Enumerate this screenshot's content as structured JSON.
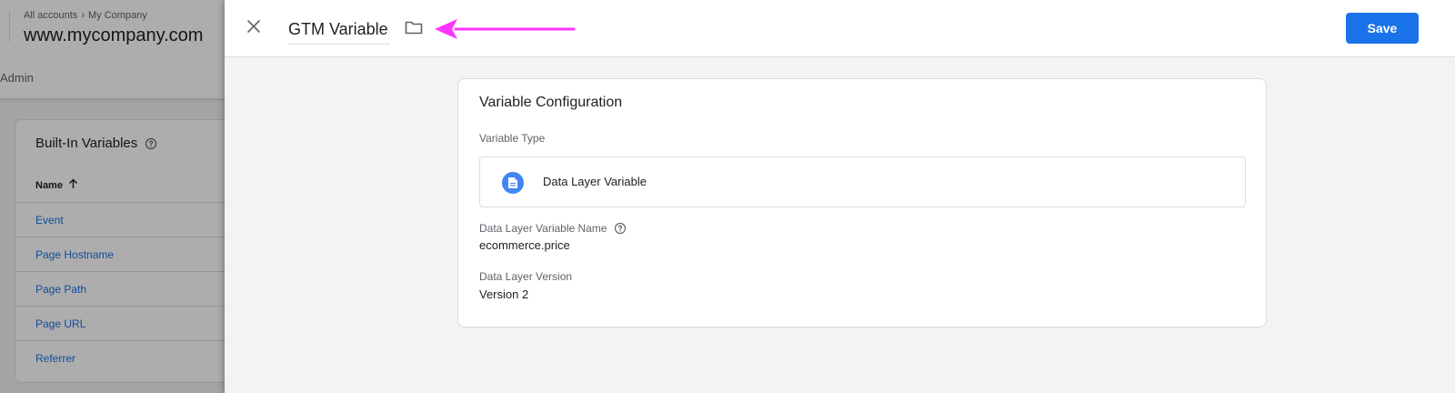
{
  "background": {
    "breadcrumb": [
      "All accounts",
      "My Company"
    ],
    "container_name": "www.mycompany.com",
    "admin_tab": "Admin",
    "builtin_card": {
      "title": "Built-In Variables",
      "column_header": "Name",
      "rows": [
        "Event",
        "Page Hostname",
        "Page Path",
        "Page URL",
        "Referrer"
      ]
    }
  },
  "panel": {
    "title": "GTM Variable",
    "save_label": "Save",
    "colors": {
      "accent": "#1a73e8",
      "annotation_arrow": "#ff33ff",
      "type_icon": "#4285f4"
    },
    "icons": [
      "close-icon",
      "folder-icon",
      "arrow-annotation",
      "document-icon",
      "help-icon"
    ],
    "config": {
      "title": "Variable Configuration",
      "type_label": "Variable Type",
      "type_name": "Data Layer Variable",
      "var_name_label": "Data Layer Variable Name",
      "var_name_value": "ecommerce.price",
      "version_label": "Data Layer Version",
      "version_value": "Version 2"
    }
  }
}
